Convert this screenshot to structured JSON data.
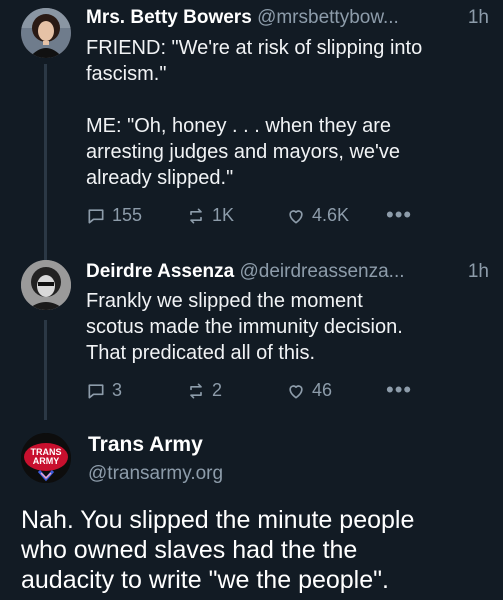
{
  "posts": [
    {
      "name": "Mrs. Betty Bowers",
      "handle": "@mrsbettybow...",
      "time": "1h",
      "text": "FRIEND: \"We're at risk of slipping into\nfascism.\"\n\nME: \"Oh, honey . . . when they are\narresting judges and mayors, we've\nalready slipped.\"",
      "replies": "155",
      "reposts": "1K",
      "likes": "4.6K"
    },
    {
      "name": "Deirdre Assenza",
      "handle": "@deirdreassenza...",
      "time": "1h",
      "text": "Frankly we slipped the moment\nscotus made the immunity decision.\nThat predicated all of this.",
      "replies": "3",
      "reposts": "2",
      "likes": "46"
    },
    {
      "name": "Trans Army",
      "handle": "@transarmy.org",
      "avatar_text": "TRANS\nARMY",
      "text": "Nah. You slipped the minute people\nwho owned slaves had the the\naudacity to write \"we the people\"."
    }
  ],
  "more_label": "•••",
  "icons": {
    "reply": "speech-bubble-icon",
    "repost": "repost-icon",
    "like": "heart-icon",
    "more": "more-icon"
  },
  "colors": {
    "background": "#121b24",
    "muted": "#8d9caa",
    "thread_line": "#2b3845",
    "trans_army_red": "#c8102e"
  }
}
